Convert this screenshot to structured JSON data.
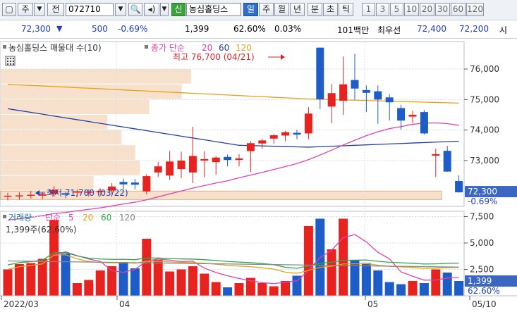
{
  "toolbar": {
    "chart_type_label": "주",
    "jeon_label": "전",
    "code": "072710",
    "stock_name": "농심홀딩스",
    "sin_label": "신",
    "periods": [
      "일",
      "주",
      "월",
      "년",
      "분",
      "초",
      "틱"
    ],
    "selected_period": "일",
    "intervals": [
      "1",
      "3",
      "5",
      "10",
      "20",
      "30",
      "60",
      "120"
    ]
  },
  "quote": {
    "price": "72,300",
    "change": "500",
    "change_pct": "-0.69%",
    "volume": "1,399",
    "vol_pct": "62.60%",
    "turnover": "0.03%",
    "amount": "101백만",
    "broker_label": "최우선",
    "ask": "72,400",
    "bid": "72,200",
    "extra": "시"
  },
  "price_panel": {
    "title": "농심홀딩스 매물대 수(10)",
    "ma_label": "종가 단순",
    "ma_periods": [
      "20",
      "60",
      "120"
    ],
    "high_label": "최고 76,700 (04/21)",
    "low_label": "최저 71,700 (03/22)",
    "current_price": "72,300",
    "current_change": "-0.69%",
    "y_ticks": [
      "76,000",
      "75,000",
      "74,000",
      "73,000"
    ]
  },
  "volume_panel": {
    "title": "거래량",
    "ma_label": "단순",
    "ma_periods": [
      "5",
      "20",
      "60",
      "120"
    ],
    "info": "1,399주(62.60%)",
    "current_volume": "1,399",
    "current_pct": "62.60%",
    "y_ticks": [
      "7,500",
      "5,000",
      "2,500"
    ]
  },
  "date_labels": [
    "2022/03",
    "04",
    "05",
    "05/10"
  ],
  "colors": {
    "up": "#e8231f",
    "down": "#1e5cc8",
    "ma20": "#e040b0",
    "ma60": "#1f3fa8",
    "ma120": "#e3a21a",
    "vol_ma5": "#e040b0",
    "vol_ma20": "#e3a21a",
    "vol_ma60": "#2ea84a",
    "vol_ma120": "#888888",
    "profile": "#f7e1cc"
  },
  "chart_data": {
    "type": "candlestick",
    "ylim": [
      71500,
      76900
    ],
    "volume_ylim": [
      0,
      8000
    ],
    "candles": [
      {
        "o": 71820,
        "h": 71950,
        "l": 71700,
        "c": 71850,
        "v": 2500
      },
      {
        "o": 71830,
        "h": 71960,
        "l": 71720,
        "c": 71860,
        "v": 3000
      },
      {
        "o": 71870,
        "h": 72010,
        "l": 71760,
        "c": 71880,
        "v": 3100
      },
      {
        "o": 71850,
        "h": 71970,
        "l": 71740,
        "c": 71900,
        "v": 3500
      },
      {
        "o": 71910,
        "h": 72160,
        "l": 71830,
        "c": 72030,
        "v": 7200
      },
      {
        "o": 71930,
        "h": 71970,
        "l": 71770,
        "c": 71880,
        "v": 4000
      },
      {
        "o": 71950,
        "h": 72050,
        "l": 71810,
        "c": 71990,
        "v": 1200
      },
      {
        "o": 71950,
        "h": 72060,
        "l": 71820,
        "c": 71980,
        "v": 1500
      },
      {
        "o": 71970,
        "h": 72090,
        "l": 71840,
        "c": 72010,
        "v": 2400
      },
      {
        "o": 72020,
        "h": 72260,
        "l": 71920,
        "c": 72150,
        "v": 2800
      },
      {
        "o": 72300,
        "h": 72410,
        "l": 72050,
        "c": 72220,
        "v": 3200
      },
      {
        "o": 72280,
        "h": 72400,
        "l": 72060,
        "c": 72210,
        "v": 2600
      },
      {
        "o": 71990,
        "h": 72550,
        "l": 71890,
        "c": 72490,
        "v": 5400
      },
      {
        "o": 72610,
        "h": 72950,
        "l": 72460,
        "c": 72810,
        "v": 3400
      },
      {
        "o": 72510,
        "h": 73310,
        "l": 72360,
        "c": 72970,
        "v": 2300
      },
      {
        "o": 72720,
        "h": 73290,
        "l": 72420,
        "c": 73000,
        "v": 2500
      },
      {
        "o": 72610,
        "h": 74110,
        "l": 72260,
        "c": 73150,
        "v": 2800
      },
      {
        "o": 73000,
        "h": 73310,
        "l": 72450,
        "c": 73050,
        "v": 2100
      },
      {
        "o": 72950,
        "h": 73140,
        "l": 72540,
        "c": 73100,
        "v": 1300
      },
      {
        "o": 73120,
        "h": 73200,
        "l": 72810,
        "c": 73020,
        "v": 800
      },
      {
        "o": 73020,
        "h": 73210,
        "l": 72810,
        "c": 73070,
        "v": 1200
      },
      {
        "o": 73310,
        "h": 73640,
        "l": 72630,
        "c": 73570,
        "v": 1700
      },
      {
        "o": 73560,
        "h": 73710,
        "l": 73390,
        "c": 73660,
        "v": 1200
      },
      {
        "o": 73720,
        "h": 73870,
        "l": 73560,
        "c": 73830,
        "v": 900
      },
      {
        "o": 73820,
        "h": 73970,
        "l": 73630,
        "c": 73930,
        "v": 1400
      },
      {
        "o": 73910,
        "h": 74010,
        "l": 73700,
        "c": 73850,
        "v": 1900
      },
      {
        "o": 73890,
        "h": 74750,
        "l": 73700,
        "c": 74540,
        "v": 6600
      },
      {
        "o": 76700,
        "h": 76710,
        "l": 74690,
        "c": 75010,
        "v": 7300
      },
      {
        "o": 74770,
        "h": 75510,
        "l": 74220,
        "c": 75210,
        "v": 4400
      },
      {
        "o": 74960,
        "h": 76410,
        "l": 74500,
        "c": 75500,
        "v": 7300
      },
      {
        "o": 75640,
        "h": 76500,
        "l": 74990,
        "c": 75360,
        "v": 3400
      },
      {
        "o": 75310,
        "h": 75460,
        "l": 74590,
        "c": 75220,
        "v": 3100
      },
      {
        "o": 75270,
        "h": 75460,
        "l": 74210,
        "c": 75000,
        "v": 2400
      },
      {
        "o": 75070,
        "h": 75170,
        "l": 74310,
        "c": 74910,
        "v": 1300
      },
      {
        "o": 74720,
        "h": 74830,
        "l": 74010,
        "c": 74310,
        "v": 1100
      },
      {
        "o": 74440,
        "h": 74630,
        "l": 74230,
        "c": 74500,
        "v": 1400
      },
      {
        "o": 74590,
        "h": 74660,
        "l": 73850,
        "c": 73890,
        "v": 1200
      },
      {
        "o": 73160,
        "h": 73390,
        "l": 72460,
        "c": 73210,
        "v": 2500
      },
      {
        "o": 73320,
        "h": 73480,
        "l": 72630,
        "c": 72640,
        "v": 2200
      },
      {
        "o": 72330,
        "h": 72520,
        "l": 71950,
        "c": 71960,
        "v": 1399
      }
    ]
  }
}
